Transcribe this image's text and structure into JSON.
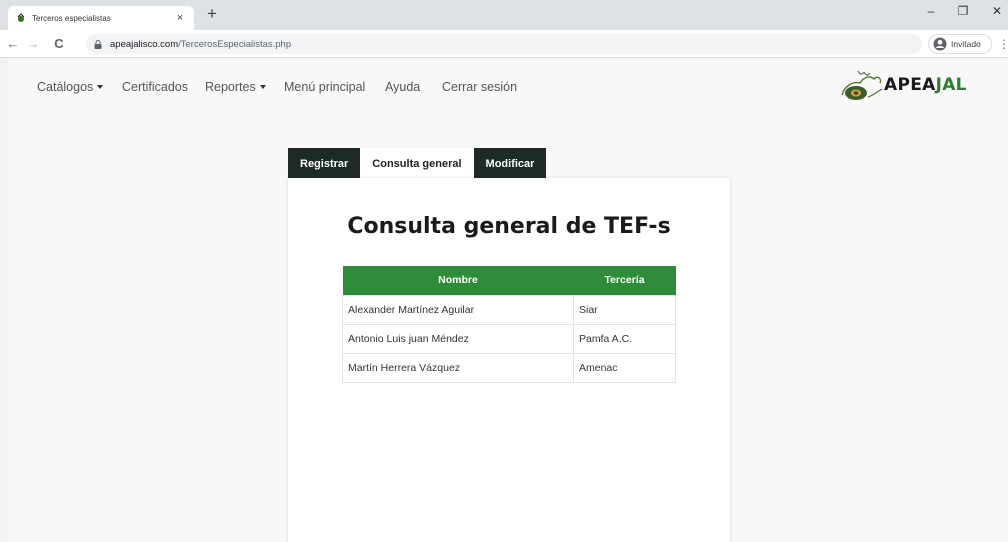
{
  "browser": {
    "tab_title": "Terceros especialistas",
    "tab_close": "×",
    "new_tab": "+",
    "url_host": "apeajalisco.com",
    "url_path": "/TercerosEspecialistas.php",
    "profile_label": "Invitado",
    "minimize": "–",
    "restore": "❐",
    "close": "✕",
    "back": "←",
    "forward": "→",
    "reload": "C",
    "menu": "⋮"
  },
  "navbar": {
    "catalogos": "Catálogos",
    "certificados": "Certificados",
    "reportes": "Reportes",
    "menu_principal": "Menú principal",
    "ayuda": "Ayuda",
    "cerrar_sesion": "Cerrar sesión",
    "logo_text_1": "APEA",
    "logo_text_2": "JAL"
  },
  "tabs": {
    "registrar": "Registrar",
    "consulta": "Consulta general",
    "modificar": "Modificar"
  },
  "main": {
    "title": "Consulta general de TEF-s",
    "columns": [
      "Nombre",
      "Tercería"
    ],
    "rows": [
      [
        "Alexander Martínez Aguilar",
        "Siar"
      ],
      [
        "Antonio Luis juan Méndez",
        "Pamfa A.C."
      ],
      [
        "Martín Herrera Vázquez",
        "Amenac"
      ]
    ]
  },
  "colors": {
    "table_header": "#2e8b3a",
    "tab_dark": "#1e2a24",
    "brand_accent": "#2e7d32"
  },
  "icons": {
    "favicon": "apeajal-favicon-icon",
    "lock": "lock-icon",
    "profile": "profile-icon",
    "logo": "apeajal-logo-icon"
  }
}
